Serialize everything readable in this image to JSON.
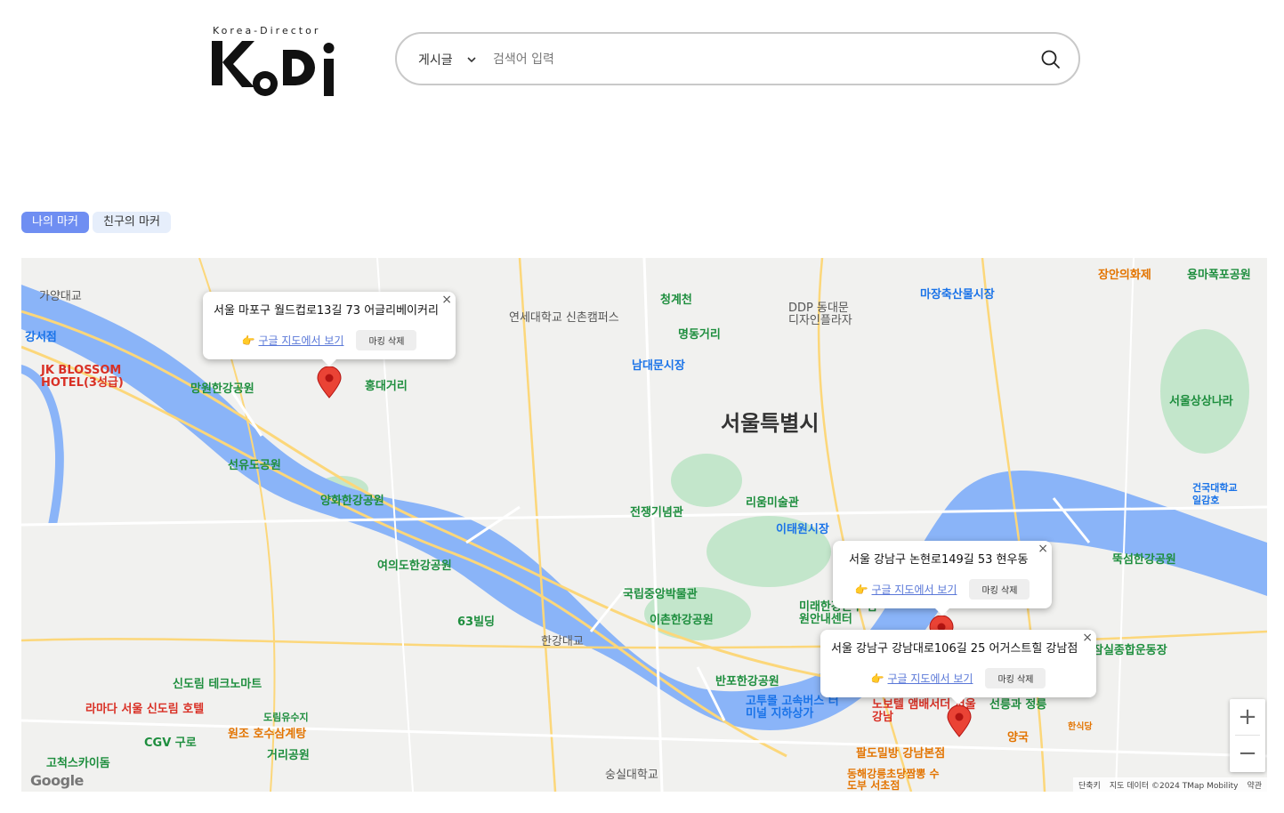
{
  "header": {
    "logo_tagline": "Korea-Director",
    "logo_text": "KoDi",
    "search": {
      "category": "게시글",
      "placeholder": "검색어 입력"
    }
  },
  "tabs": [
    {
      "label": "나의 마커",
      "active": true
    },
    {
      "label": "친구의 마커",
      "active": false
    }
  ],
  "map": {
    "city_label": "서울특별시",
    "pois": [
      {
        "text": "가양대교",
        "kind": "poi-dark"
      },
      {
        "text": "강서점",
        "kind": "poi-blue"
      },
      {
        "text": "JK BLOSSOM HOTEL(3성급)",
        "kind": "poi-red"
      },
      {
        "text": "망원한강공원",
        "kind": "poi-green"
      },
      {
        "text": "홍대거리",
        "kind": "poi-green"
      },
      {
        "text": "연세대학교 신촌캠퍼스",
        "kind": "poi-dark"
      },
      {
        "text": "청계천",
        "kind": "poi-green"
      },
      {
        "text": "명동거리",
        "kind": "poi-green"
      },
      {
        "text": "DDP 동대문 디자인플라자",
        "kind": "poi-dark"
      },
      {
        "text": "마장축산물시장",
        "kind": "poi-blue"
      },
      {
        "text": "장안의화제",
        "kind": "poi-orange"
      },
      {
        "text": "용마폭포공원",
        "kind": "poi-green"
      },
      {
        "text": "남대문시장",
        "kind": "poi-blue"
      },
      {
        "text": "서울상상나라",
        "kind": "poi-green"
      },
      {
        "text": "선유도공원",
        "kind": "poi-green"
      },
      {
        "text": "양화한강공원",
        "kind": "poi-green"
      },
      {
        "text": "리움미술관",
        "kind": "poi-green"
      },
      {
        "text": "이태원시장",
        "kind": "poi-blue"
      },
      {
        "text": "전쟁기념관",
        "kind": "poi-green"
      },
      {
        "text": "여의도한강공원",
        "kind": "poi-green"
      },
      {
        "text": "건국대학교 일감호",
        "kind": "poi-blue"
      },
      {
        "text": "뚝섬한강공원",
        "kind": "poi-green"
      },
      {
        "text": "국립중앙박물관",
        "kind": "poi-green"
      },
      {
        "text": "이촌한강공원",
        "kind": "poi-green"
      },
      {
        "text": "63빌딩",
        "kind": "poi-green"
      },
      {
        "text": "한강대교",
        "kind": "poi-dark"
      },
      {
        "text": "미래한강본부 잠원안내센터",
        "kind": "poi-green"
      },
      {
        "text": "잠실종합운동장",
        "kind": "poi-green"
      },
      {
        "text": "신도림 테크노마트",
        "kind": "poi-green"
      },
      {
        "text": "라마다 서울 신도림 호텔",
        "kind": "poi-red"
      },
      {
        "text": "반포한강공원",
        "kind": "poi-green"
      },
      {
        "text": "고투몰 고속버스 터미널 지하상가",
        "kind": "poi-blue"
      },
      {
        "text": "노보텔 앰배서더 서울 강남",
        "kind": "poi-red"
      },
      {
        "text": "선릉과 정릉",
        "kind": "poi-green"
      },
      {
        "text": "양국",
        "kind": "poi-orange"
      },
      {
        "text": "한식당",
        "kind": "poi-orange"
      },
      {
        "text": "원조 호수삼계탕",
        "kind": "poi-orange"
      },
      {
        "text": "도림유수지",
        "kind": "poi-green"
      },
      {
        "text": "CGV 구로",
        "kind": "poi-green"
      },
      {
        "text": "고척스카이돔",
        "kind": "poi-green"
      },
      {
        "text": "거리공원",
        "kind": "poi-green"
      },
      {
        "text": "숭실대학교",
        "kind": "poi-dark"
      },
      {
        "text": "팔도밀방 강남본점",
        "kind": "poi-orange"
      },
      {
        "text": "동해강릉초당짬뽕 수도부 서초점",
        "kind": "poi-orange"
      }
    ],
    "popups": [
      {
        "address": "서울 마포구 월드컵로13길 73 어글리베이커리",
        "link": "구글 지도에서 보기",
        "delete": "마킹 삭제"
      },
      {
        "address": "서울 강남구 논현로149길 53 현우동",
        "link": "구글 지도에서 보기",
        "delete": "마킹 삭제"
      },
      {
        "address": "서울 강남구 강남대로106길 25 어거스트힐 강남점",
        "link": "구글 지도에서 보기",
        "delete": "마킹 삭제"
      }
    ],
    "zoom_in": "+",
    "zoom_out": "−",
    "google_logo": "Google",
    "attribution": {
      "shortcuts": "단축키",
      "data": "지도 데이터 ©2024 TMap Mobility",
      "terms": "약관"
    }
  },
  "colors": {
    "river": "#8ab4f8",
    "park": "#c3e6cb",
    "road_major": "#fcd77a",
    "marker": "#ea4335",
    "active_tab": "#6f8ef2"
  }
}
